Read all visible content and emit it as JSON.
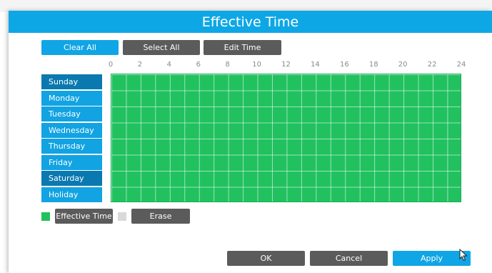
{
  "dialog": {
    "title": "Effective Time"
  },
  "toolbar": {
    "clear_all": "Clear All",
    "select_all": "Select All",
    "edit_time": "Edit Time"
  },
  "hours": [
    "0",
    "2",
    "4",
    "6",
    "8",
    "10",
    "12",
    "14",
    "16",
    "18",
    "20",
    "22",
    "24"
  ],
  "days": [
    "Sunday",
    "Monday",
    "Tuesday",
    "Wednesday",
    "Thursday",
    "Friday",
    "Saturday",
    "Holiday"
  ],
  "schedule": {
    "selected_fraction_per_day": [
      1,
      1,
      1,
      1,
      1,
      1,
      1,
      1
    ]
  },
  "legend": {
    "effective_time": "Effective Time",
    "erase": "Erase"
  },
  "footer": {
    "ok": "OK",
    "cancel": "Cancel",
    "apply": "Apply"
  },
  "colors": {
    "title_bar": "#0ea7e6",
    "effective": "#21c160",
    "erase": "#d9d9d9",
    "day_dark": "#0a79b0",
    "day_light": "#12a3e2",
    "button_gray": "#5b5b5b"
  }
}
